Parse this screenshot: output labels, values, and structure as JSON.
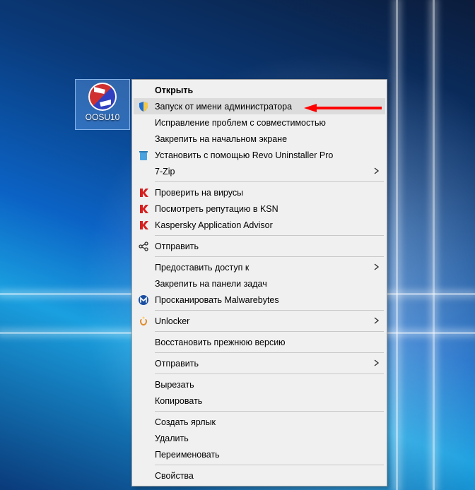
{
  "desktop": {
    "icon_label": "OOSU10"
  },
  "menu": {
    "items": [
      {
        "label": "Открыть",
        "icon": "none",
        "submenu": false,
        "bold": true,
        "highlight": false
      },
      {
        "label": "Запуск от имени администратора",
        "icon": "shield",
        "submenu": false,
        "bold": false,
        "highlight": true
      },
      {
        "label": "Исправление проблем с совместимостью",
        "icon": "none",
        "submenu": false,
        "bold": false,
        "highlight": false
      },
      {
        "label": "Закрепить на начальном экране",
        "icon": "none",
        "submenu": false,
        "bold": false,
        "highlight": false
      },
      {
        "label": "Установить с помощью Revo Uninstaller Pro",
        "icon": "revo",
        "submenu": false,
        "bold": false,
        "highlight": false
      },
      {
        "label": "7-Zip",
        "icon": "none",
        "submenu": true,
        "bold": false,
        "highlight": false
      },
      {
        "sep": true
      },
      {
        "label": "Проверить на вирусы",
        "icon": "kaspersky",
        "submenu": false,
        "bold": false,
        "highlight": false
      },
      {
        "label": "Посмотреть репутацию в KSN",
        "icon": "kaspersky",
        "submenu": false,
        "bold": false,
        "highlight": false
      },
      {
        "label": "Kaspersky Application Advisor",
        "icon": "kaspersky",
        "submenu": false,
        "bold": false,
        "highlight": false
      },
      {
        "sep": true
      },
      {
        "label": "Отправить",
        "icon": "share",
        "submenu": false,
        "bold": false,
        "highlight": false
      },
      {
        "sep": true
      },
      {
        "label": "Предоставить доступ к",
        "icon": "none",
        "submenu": true,
        "bold": false,
        "highlight": false
      },
      {
        "label": "Закрепить на панели задач",
        "icon": "none",
        "submenu": false,
        "bold": false,
        "highlight": false
      },
      {
        "label": "Просканировать Malwarebytes",
        "icon": "malwarebytes",
        "submenu": false,
        "bold": false,
        "highlight": false
      },
      {
        "sep": true
      },
      {
        "label": "Unlocker",
        "icon": "unlocker",
        "submenu": true,
        "bold": false,
        "highlight": false
      },
      {
        "sep": true
      },
      {
        "label": "Восстановить прежнюю версию",
        "icon": "none",
        "submenu": false,
        "bold": false,
        "highlight": false
      },
      {
        "sep": true
      },
      {
        "label": "Отправить",
        "icon": "none",
        "submenu": true,
        "bold": false,
        "highlight": false
      },
      {
        "sep": true
      },
      {
        "label": "Вырезать",
        "icon": "none",
        "submenu": false,
        "bold": false,
        "highlight": false
      },
      {
        "label": "Копировать",
        "icon": "none",
        "submenu": false,
        "bold": false,
        "highlight": false
      },
      {
        "sep": true
      },
      {
        "label": "Создать ярлык",
        "icon": "none",
        "submenu": false,
        "bold": false,
        "highlight": false
      },
      {
        "label": "Удалить",
        "icon": "none",
        "submenu": false,
        "bold": false,
        "highlight": false
      },
      {
        "label": "Переименовать",
        "icon": "none",
        "submenu": false,
        "bold": false,
        "highlight": false
      },
      {
        "sep": true
      },
      {
        "label": "Свойства",
        "icon": "none",
        "submenu": false,
        "bold": false,
        "highlight": false
      }
    ]
  },
  "annotation": {
    "arrow_color": "#ff0000"
  }
}
